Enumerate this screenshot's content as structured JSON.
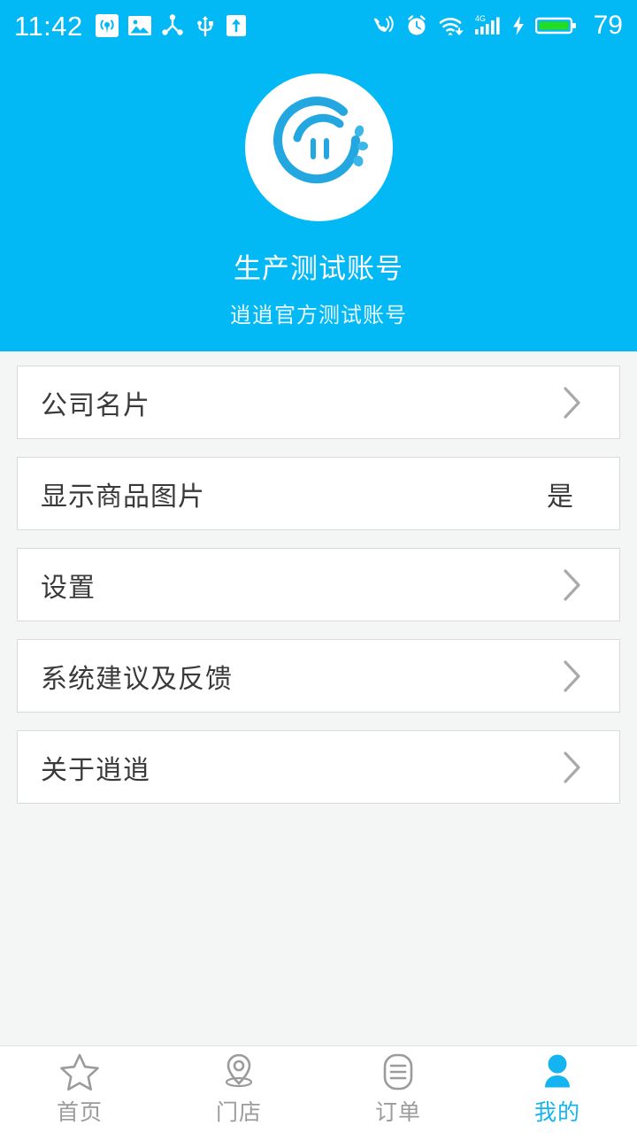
{
  "statusbar": {
    "time": "11:42",
    "battery_percent": "79",
    "left_icons": [
      "hotspot-icon",
      "image-icon",
      "share-nodes-icon",
      "usb-icon",
      "upload-icon"
    ],
    "right_icons": [
      "vibrate-call-icon",
      "alarm-clock-icon",
      "wifi-download-icon",
      "signal-4g-icon",
      "charging-bolt-icon",
      "battery-icon"
    ],
    "network_label": "4G"
  },
  "header": {
    "avatar_icon": "xiaoxiao-logo",
    "account_name": "生产测试账号",
    "account_subtitle": "逍逍官方测试账号"
  },
  "menu": {
    "rows": [
      {
        "label": "公司名片",
        "value": "",
        "has_chevron": true
      },
      {
        "label": "显示商品图片",
        "value": "是",
        "has_chevron": false
      },
      {
        "label": "设置",
        "value": "",
        "has_chevron": true
      },
      {
        "label": "系统建议及反馈",
        "value": "",
        "has_chevron": true
      },
      {
        "label": "关于逍逍",
        "value": "",
        "has_chevron": true
      }
    ]
  },
  "tabbar": {
    "tabs": [
      {
        "label": "首页",
        "icon": "star-icon",
        "active": false
      },
      {
        "label": "门店",
        "icon": "location-pin-icon",
        "active": false
      },
      {
        "label": "订单",
        "icon": "order-list-icon",
        "active": false
      },
      {
        "label": "我的",
        "icon": "person-icon",
        "active": true
      }
    ]
  },
  "colors": {
    "brand_blue": "#02b8f5",
    "accent_blue": "#14b4f0",
    "page_background": "#f4f5f5",
    "card_background": "#ffffff",
    "card_border": "#d9dadb",
    "text_primary": "#3a3a3a",
    "text_muted": "#9b9b9b",
    "battery_green": "#22dd22"
  }
}
